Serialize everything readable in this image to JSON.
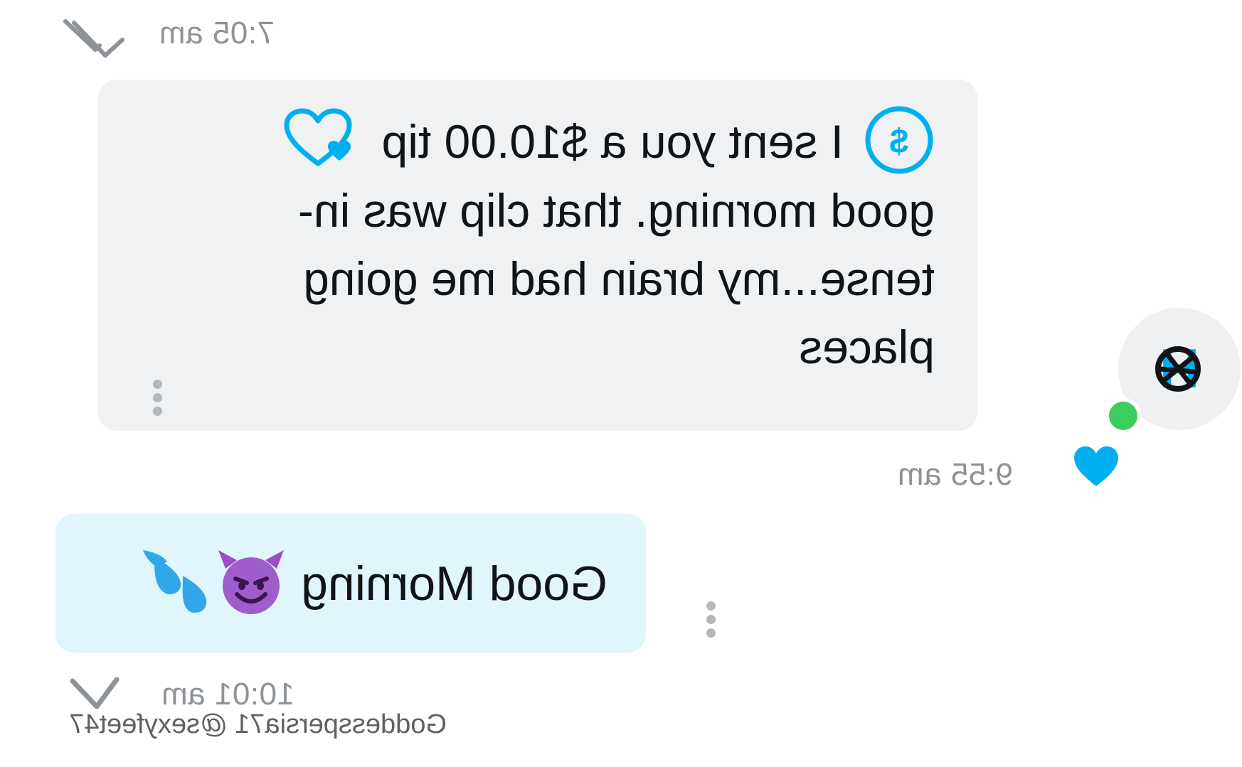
{
  "messages": [
    {
      "direction": "received",
      "tip": {
        "label": "I sent you a $10.00 tip",
        "icon": "dollar-circle-icon",
        "reaction_icon": "heart-outline-icon"
      },
      "text": "good morning. that clip was in-tense...my brain had me going places",
      "time": "9:55 am",
      "liked": true
    },
    {
      "direction": "sent",
      "text": "Good Morning",
      "emoji": [
        "smiling-imp-emoji",
        "sweat-droplets-emoji"
      ],
      "time": "10:01 am",
      "status_icon": "single-check-icon"
    }
  ],
  "top_timestamp": {
    "time": "7:05 am",
    "status_icon": "double-check-icon"
  },
  "watermark": "Goddesspersia71 @sexyfeet47",
  "colors": {
    "accent": "#00aff0",
    "incoming_bubble": "#eff1f2",
    "outgoing_bubble": "#e1f5fd",
    "online": "#3ccd5e",
    "timestamp": "#8e9398"
  }
}
